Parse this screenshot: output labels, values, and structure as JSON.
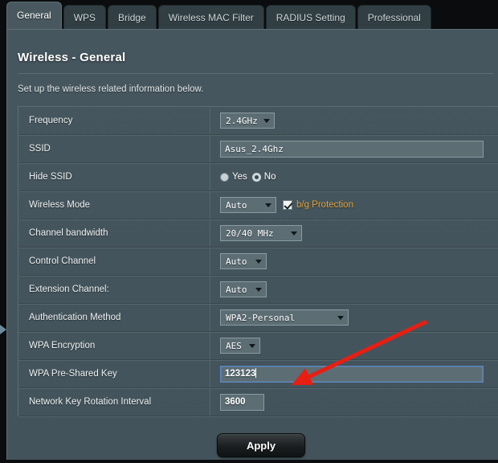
{
  "tabs": [
    {
      "label": "General",
      "active": true
    },
    {
      "label": "WPS",
      "active": false
    },
    {
      "label": "Bridge",
      "active": false
    },
    {
      "label": "Wireless MAC Filter",
      "active": false
    },
    {
      "label": "RADIUS Setting",
      "active": false
    },
    {
      "label": "Professional",
      "active": false
    }
  ],
  "page": {
    "title": "Wireless - General",
    "description": "Set up the wireless related information below."
  },
  "settings": {
    "frequency": {
      "label": "Frequency",
      "value": "2.4GHz",
      "control": "select"
    },
    "ssid": {
      "label": "SSID",
      "value": "Asus_2.4Ghz",
      "control": "text"
    },
    "hide_ssid": {
      "label": "Hide SSID",
      "options": [
        {
          "label": "Yes",
          "checked": false
        },
        {
          "label": "No",
          "checked": true
        }
      ],
      "control": "radio"
    },
    "wireless_mode": {
      "label": "Wireless Mode",
      "value": "Auto",
      "control": "select",
      "checkbox": {
        "label": "b/g Protection",
        "checked": true,
        "color": "#e2a43c"
      }
    },
    "channel_bandwidth": {
      "label": "Channel bandwidth",
      "value": "20/40 MHz",
      "control": "select"
    },
    "control_channel": {
      "label": "Control Channel",
      "value": "Auto",
      "control": "select"
    },
    "extension_channel": {
      "label": "Extension Channel:",
      "value": "Auto",
      "control": "select"
    },
    "authentication_method": {
      "label": "Authentication Method",
      "value": "WPA2-Personal",
      "control": "select"
    },
    "wpa_encryption": {
      "label": "WPA Encryption",
      "value": "AES",
      "control": "select"
    },
    "wpa_psk": {
      "label": "WPA Pre-Shared Key",
      "value": "123123",
      "control": "text",
      "focused": true
    },
    "key_rotation": {
      "label": "Network Key Rotation Interval",
      "value": "3600",
      "control": "text"
    }
  },
  "footer": {
    "apply_label": "Apply"
  },
  "annotation": {
    "type": "arrow",
    "color": "#e81e12",
    "points_to": "wpa-psk-input"
  },
  "colors": {
    "panel_bg": "#46565e",
    "tab_active_bg": "#48585e",
    "tab_inactive_bg": "#313f45",
    "accent_orange": "#e2a43c",
    "focus_blue": "#5b86c4",
    "annotation_red": "#e81e12"
  }
}
